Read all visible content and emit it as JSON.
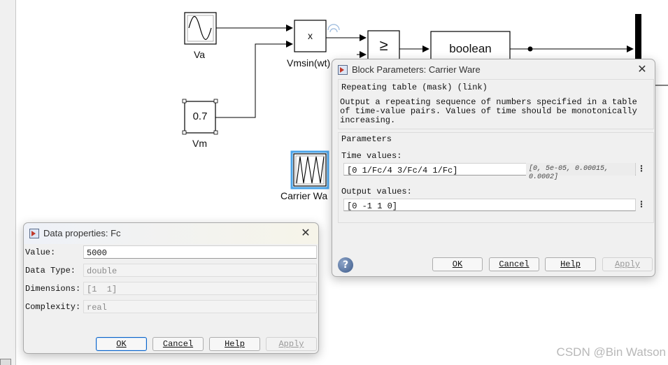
{
  "model": {
    "blocks": {
      "va_label": "Va",
      "vm_value": "0.7",
      "vm_label": "Vm",
      "product_symbol": "x",
      "product_label": "Vmsin(wt)",
      "relational_symbol": "≥",
      "boolean_text": "boolean",
      "carrier_label": "Carrier Wa"
    }
  },
  "block_dialog": {
    "title": "Block Parameters: Carrier Ware",
    "mask_header": "Repeating table (mask) (link)",
    "description": "Output a repeating sequence of numbers specified in a table of time-value pairs. Values of time should be monotonically increasing.",
    "parameters_header": "Parameters",
    "time_label": "Time values:",
    "time_value": "[0 1/Fc/4 3/Fc/4 1/Fc]",
    "time_hint": "[0, 5e-05, 0.00015, 0.0002]",
    "output_label": "Output values:",
    "output_value": "[0 -1 1 0]",
    "buttons": {
      "ok": "OK",
      "cancel": "Cancel",
      "help": "Help",
      "apply": "Apply"
    },
    "help_icon_glyph": "?"
  },
  "data_dialog": {
    "title": "Data properties: Fc",
    "rows": [
      {
        "label": "Value:",
        "value": "5000"
      },
      {
        "label": "Data Type:",
        "value": "double"
      },
      {
        "label": "Dimensions:",
        "value": "[1  1]"
      },
      {
        "label": "Complexity:",
        "value": "real"
      }
    ],
    "buttons": {
      "ok": "OK",
      "cancel": "Cancel",
      "help": "Help",
      "apply": "Apply"
    }
  },
  "close_glyph": "✕",
  "more_glyph": "⋮",
  "watermark": "CSDN @Bin Watson",
  "colors": {
    "accent": "#0a64c8",
    "selection": "#4aa3e8"
  }
}
